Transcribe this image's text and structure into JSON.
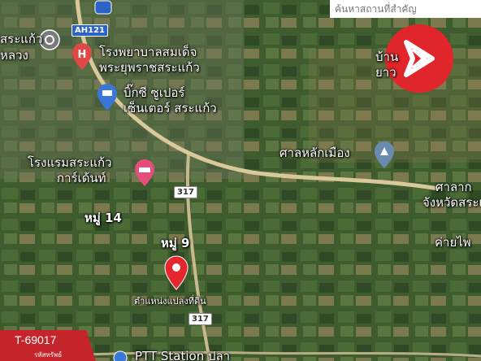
{
  "search": {
    "placeholder": "ค้นหาสถานที่สำคัญ"
  },
  "logo": {
    "icon": "brand-logo-icon",
    "color": "#e0262a"
  },
  "badge": {
    "code": "T-69017",
    "sub": "รหัสทรัพย์"
  },
  "roads": {
    "ah121": "AH121",
    "r317_top": "317",
    "r317_bottom": "317"
  },
  "places": {
    "hospital": [
      "โรงพยาบาลสมเด็จ",
      "พระยุพราชสระแก้ว"
    ],
    "bigc": [
      "บิ๊กซี ซูเปอร์",
      "เซ็นเตอร์ สระแก้ว"
    ],
    "hotel": [
      "โรงแรมสระแก้ว",
      "การ์เด้นท์"
    ],
    "shrine": "ศาลหลักเมือง",
    "courthouse": [
      "ศาลาก",
      "จังหวัดสระแ"
    ],
    "camp": "ค่ายไพ",
    "village14": "หมู่ 14",
    "village9": "หมู่ 9",
    "plot": "ตำแหน่งแปลงที่ดิน",
    "ptt": "PTT Station ปลา",
    "top_left_a": "สระแก้ว",
    "top_left_b": "หลวง",
    "top_right": [
      "บ้าน",
      "ยาว"
    ]
  },
  "colors": {
    "pin": "#e5262f",
    "hospital": "#e04848",
    "shopping": "#3a78d8",
    "hotel": "#e34f7a",
    "road": "#c9b98e"
  }
}
